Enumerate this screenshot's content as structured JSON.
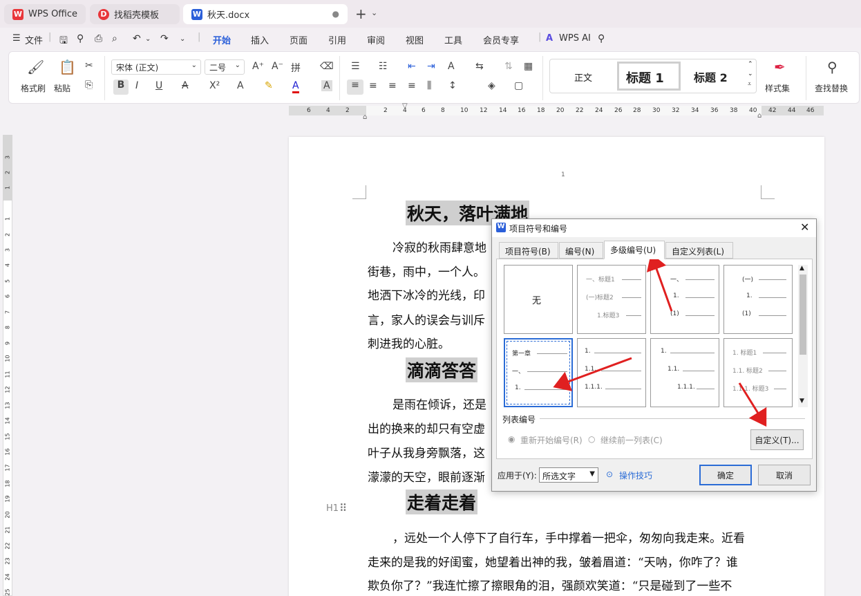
{
  "tabs": [
    {
      "label": "WPS Office",
      "icon": "wps-logo-icon"
    },
    {
      "label": "找稻壳模板",
      "icon": "docer-icon"
    },
    {
      "label": "秋天.docx",
      "icon": "word-doc-icon"
    }
  ],
  "menu": {
    "file": "文件",
    "items": [
      "开始",
      "插入",
      "页面",
      "引用",
      "审阅",
      "视图",
      "工具",
      "会员专享"
    ],
    "active": "开始",
    "wps_ai": "WPS AI"
  },
  "ribbon": {
    "format_painter": "格式刷",
    "paste": "粘贴",
    "font_name": "宋体 (正文)",
    "font_size": "二号",
    "styles": [
      "正文",
      "标题 1",
      "标题 2"
    ],
    "style_set": "样式集",
    "find_replace": "查找替换"
  },
  "ruler": {
    "numbers": [
      "6",
      "4",
      "2",
      "2",
      "4",
      "6",
      "8",
      "10",
      "12",
      "14",
      "16",
      "18",
      "20",
      "22",
      "24",
      "26",
      "28",
      "30",
      "32",
      "34",
      "36",
      "38",
      "40",
      "42",
      "44",
      "46"
    ]
  },
  "vruler": {
    "numbers": [
      "3",
      "2",
      "1",
      "1",
      "2",
      "3",
      "4",
      "5",
      "6",
      "7",
      "8",
      "9",
      "10",
      "11",
      "12",
      "13",
      "14",
      "15",
      "16",
      "17",
      "18",
      "19",
      "20",
      "21",
      "22",
      "23",
      "24",
      "25"
    ]
  },
  "document": {
    "page_number": "1",
    "heading1": "秋天，落叶满地",
    "para1": [
      "冷寂的秋雨肆意地",
      "街巷，雨中，一个人。",
      "地洒下冰冷的光线，印",
      "言，家人的误会与训斥",
      "刺进我的心脏。"
    ],
    "heading2": "滴滴答答",
    "para2": [
      "是雨在倾诉，还是",
      "出的换来的却只有空虚",
      "叶子从我身旁飘落，这",
      "濛濛的天空，眼前逐渐"
    ],
    "heading3": "走着走着",
    "para3": [
      "，远处一个人停下了自行车，手中撑着一把伞，匆匆向我走来。近看",
      "走来的是我的好闺蜜，她望着出神的我，皱着眉道：“天呐，你咋了？谁",
      "欺负你了？”我连忙擦了擦眼角的泪，强颜欢笑道：“只是碰到了一些不"
    ],
    "heading_marker": "H1"
  },
  "dialog": {
    "title": "项目符号和编号",
    "tabs": [
      "项目符号(B)",
      "编号(N)",
      "多级编号(U)",
      "自定义列表(L)"
    ],
    "active_tab": "多级编号(U)",
    "none_label": "无",
    "cells": [
      {
        "rows": [
          "一、标题1",
          "(一)标题2",
          "1.标题3"
        ]
      },
      {
        "rows": [
          "一、",
          "1.",
          "(1)"
        ]
      },
      {
        "rows": [
          "(一)",
          "1.",
          "(1)"
        ]
      },
      {
        "rows": [
          "第一章",
          "一、",
          "1."
        ]
      },
      {
        "rows": [
          "1.",
          "1.1.",
          "1.1.1."
        ]
      },
      {
        "rows": [
          "1.",
          "1.1.",
          "1.1.1."
        ]
      },
      {
        "rows": [
          "1. 标题1",
          "1.1. 标题2",
          "1.1.1. 标题3"
        ]
      }
    ],
    "list_numbering_label": "列表编号",
    "restart": "重新开始编号(R)",
    "continue": "继续前一列表(C)",
    "customize": "自定义(T)...",
    "apply_to_label": "应用于(Y):",
    "apply_to_value": "所选文字",
    "tips": "操作技巧",
    "ok": "确定",
    "cancel": "取消"
  },
  "colors": {
    "accent": "#2b5fd9",
    "arrow": "#e02020",
    "wps_red": "#e8363a"
  }
}
